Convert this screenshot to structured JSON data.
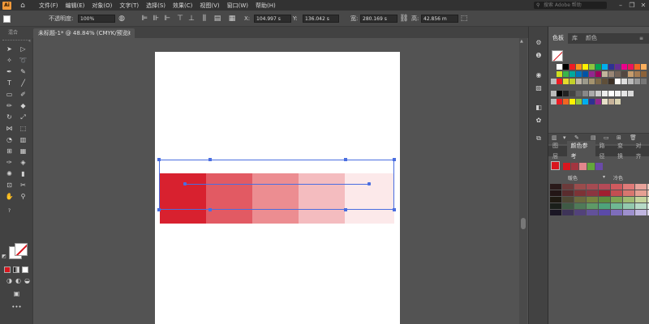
{
  "app": {
    "logo_text": "Ai"
  },
  "menus": [
    "文件(F)",
    "编辑(E)",
    "对象(O)",
    "文字(T)",
    "选择(S)",
    "效果(C)",
    "视图(V)",
    "窗口(W)",
    "帮助(H)"
  ],
  "search": {
    "placeholder": "搜索 Adobe 帮助"
  },
  "control_bar": {
    "opacity_label": "不透明度:",
    "opacity_value": "100%",
    "x_label": "X:",
    "x_value": "104.997 s",
    "y_label": "Y:",
    "y_value": "136.042 s",
    "w_label": "宽:",
    "w_value": "280.169 s",
    "h_label": "高:",
    "h_value": "42.856 m"
  },
  "subbar": {
    "label": "混合"
  },
  "document_tab": {
    "title": "未标题-1* @ 48.84% (CMYK/预览)",
    "close": "×"
  },
  "toolbar": {
    "more": "•••",
    "collapse": "«"
  },
  "blend_colors": [
    "#d8212f",
    "#e25a63",
    "#ec8d91",
    "#f4bcbf",
    "#fce9ea"
  ],
  "swatches_panel": {
    "tabs": [
      "色板",
      "库",
      "颜色"
    ],
    "active_tab": "色板",
    "footer_icons": [
      "library-icon",
      "show-menu-icon",
      "swatch-options-icon",
      "color-group-icon",
      "new-group-icon",
      "new-swatch-icon",
      "delete-icon"
    ]
  },
  "guide_panel": {
    "tabs": [
      "图层",
      "颜色参考",
      "路径",
      "变换",
      "对齐"
    ],
    "active_tab": "颜色参考",
    "base_colors": [
      "#d8161e",
      "#a33540",
      "#e2868c",
      "#63a63b",
      "#6a4aa8"
    ],
    "label1": "暖色",
    "label2": "冷色",
    "dropdown": "▾"
  },
  "colors": {
    "menu_bg": "#323232",
    "panel_bg": "#535353",
    "selection": "#4a6ee0",
    "accent_red": "#d8161e"
  }
}
